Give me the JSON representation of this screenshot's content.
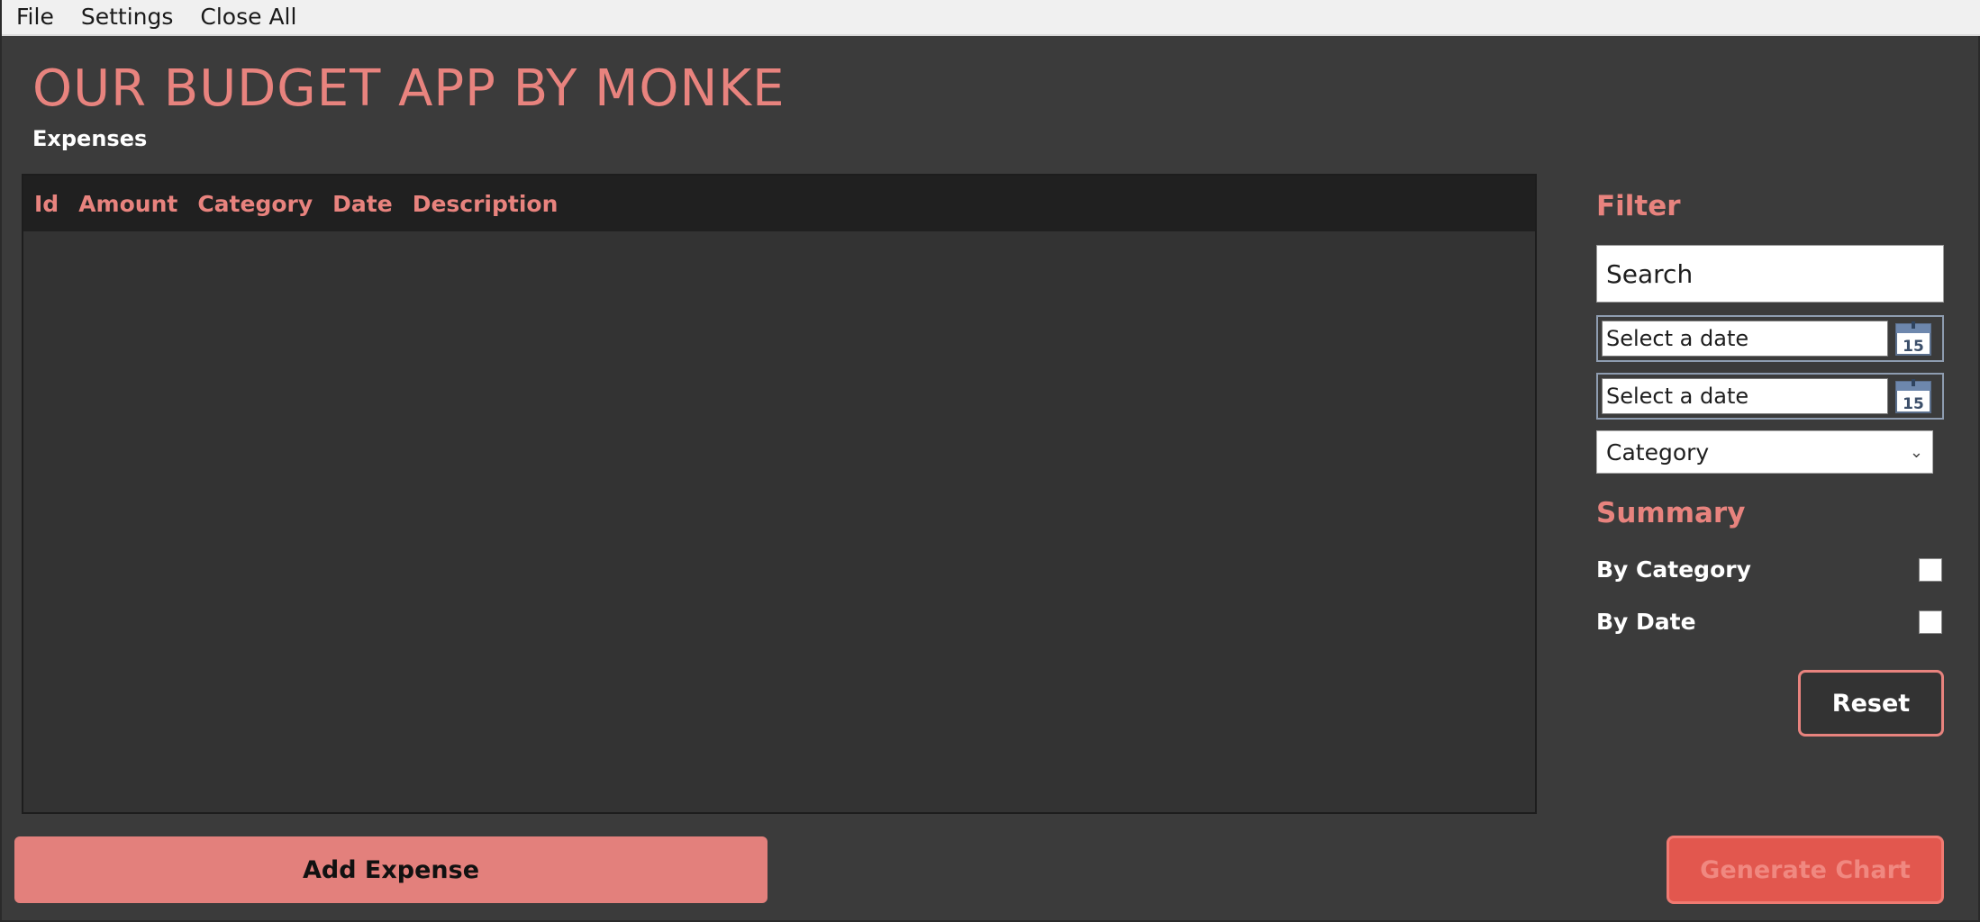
{
  "menu": {
    "items": [
      "File",
      "Settings",
      "Close All"
    ]
  },
  "header": {
    "title": "OUR BUDGET APP BY MONKE",
    "section": "Expenses"
  },
  "grid": {
    "columns": [
      "Id",
      "Amount",
      "Category",
      "Date",
      "Description"
    ],
    "rows": []
  },
  "filter": {
    "title": "Filter",
    "search_value": "Search",
    "start_date_placeholder": "Select a date",
    "end_date_placeholder": "Select a date",
    "calendar_icon_day": "15",
    "category_selected": "Category"
  },
  "summary": {
    "title": "Summary",
    "by_category_label": "By Category",
    "by_category_checked": false,
    "by_date_label": "By Date",
    "by_date_checked": false
  },
  "buttons": {
    "reset": "Reset",
    "add_expense": "Add Expense",
    "generate_chart": "Generate Chart"
  },
  "colors": {
    "accent": "#e8837e",
    "background": "#3b3b3b",
    "grid_header": "#202020",
    "generate_button": "#e2574e"
  }
}
